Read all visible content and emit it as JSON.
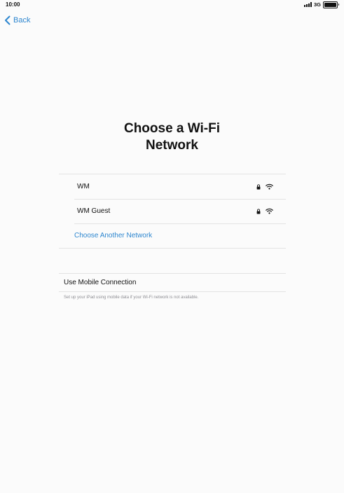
{
  "status_bar": {
    "time": "10:00",
    "network_type": "3G",
    "icons": [
      "signal-bars-icon",
      "battery-icon"
    ]
  },
  "nav": {
    "back_label": "Back",
    "back_icon": "chevron-left-icon"
  },
  "title": "Choose a Wi-Fi\nNetwork",
  "networks": [
    {
      "name": "WM",
      "secured": true,
      "icons": [
        "lock-icon",
        "wifi-icon"
      ]
    },
    {
      "name": "WM Guest",
      "secured": true,
      "icons": [
        "lock-icon",
        "wifi-icon"
      ]
    }
  ],
  "other_network_label": "Choose Another Network",
  "mobile": {
    "label": "Use Mobile Connection",
    "caption": "Set up your iPad using mobile data if your Wi-Fi network is not available."
  },
  "colors": {
    "accent": "#2d86cf",
    "background": "#fbfbfb",
    "separator": "#e3e3e3",
    "caption": "#8e8e93"
  }
}
